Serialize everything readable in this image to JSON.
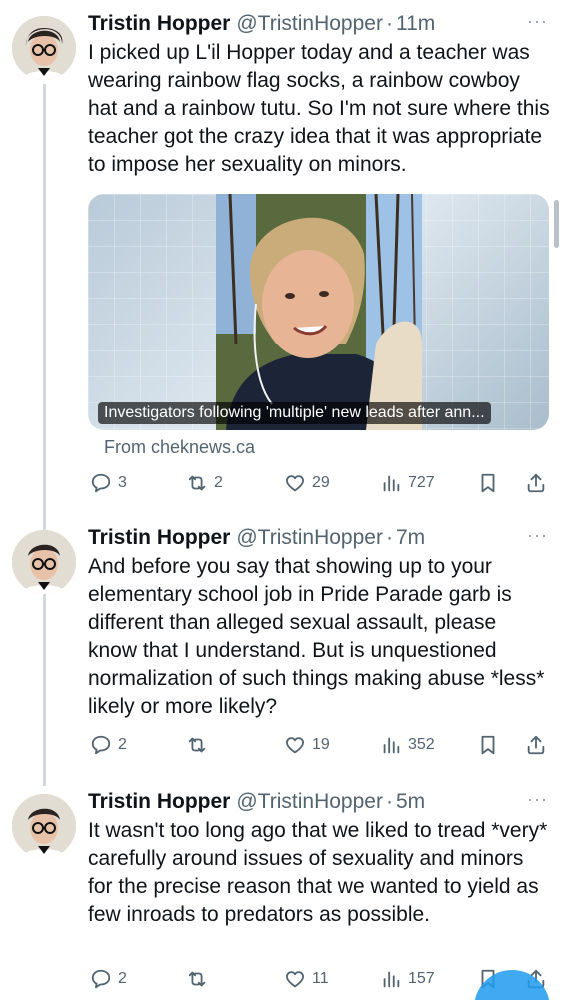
{
  "tweets": [
    {
      "name": "Tristin Hopper",
      "handle": "@TristinHopper",
      "separator": "·",
      "time": "11m",
      "more": "···",
      "text": "I picked up L'il Hopper today and a teacher was wearing rainbow flag socks, a rainbow cowboy hat and a rainbow tutu. So I'm not sure where this teacher got the crazy idea that it was appropriate to impose her sexuality on minors.",
      "card": {
        "caption": "Investigators following 'multiple' new leads after ann...",
        "source": "From cheknews.ca"
      },
      "replies": "3",
      "retweets": "2",
      "likes": "29",
      "views": "727"
    },
    {
      "name": "Tristin Hopper",
      "handle": "@TristinHopper",
      "separator": "·",
      "time": "7m",
      "more": "···",
      "text": "And before you say that showing up to your elementary school job in Pride Parade garb is different than alleged sexual assault, please know that I understand. But is unquestioned normalization of such things making abuse *less* likely or more likely?",
      "replies": "2",
      "retweets": "",
      "likes": "19",
      "views": "352"
    },
    {
      "name": "Tristin Hopper",
      "handle": "@TristinHopper",
      "separator": "·",
      "time": "5m",
      "more": "···",
      "text": "It wasn't too long ago that we liked to tread *very* carefully around issues of sexuality and minors for the precise reason that we wanted to yield as few inroads to predators as possible.",
      "replies": "2",
      "retweets": "",
      "likes": "11",
      "views": "157"
    }
  ],
  "icons": {
    "reply": "reply-icon",
    "retweet": "retweet-icon",
    "like": "heart-icon",
    "views": "views-icon",
    "bookmark": "bookmark-icon",
    "share": "share-icon"
  },
  "colors": {
    "text": "#0f1419",
    "secondary": "#536471",
    "thread_line": "#cfd9de",
    "accent": "#1d9bf0"
  }
}
